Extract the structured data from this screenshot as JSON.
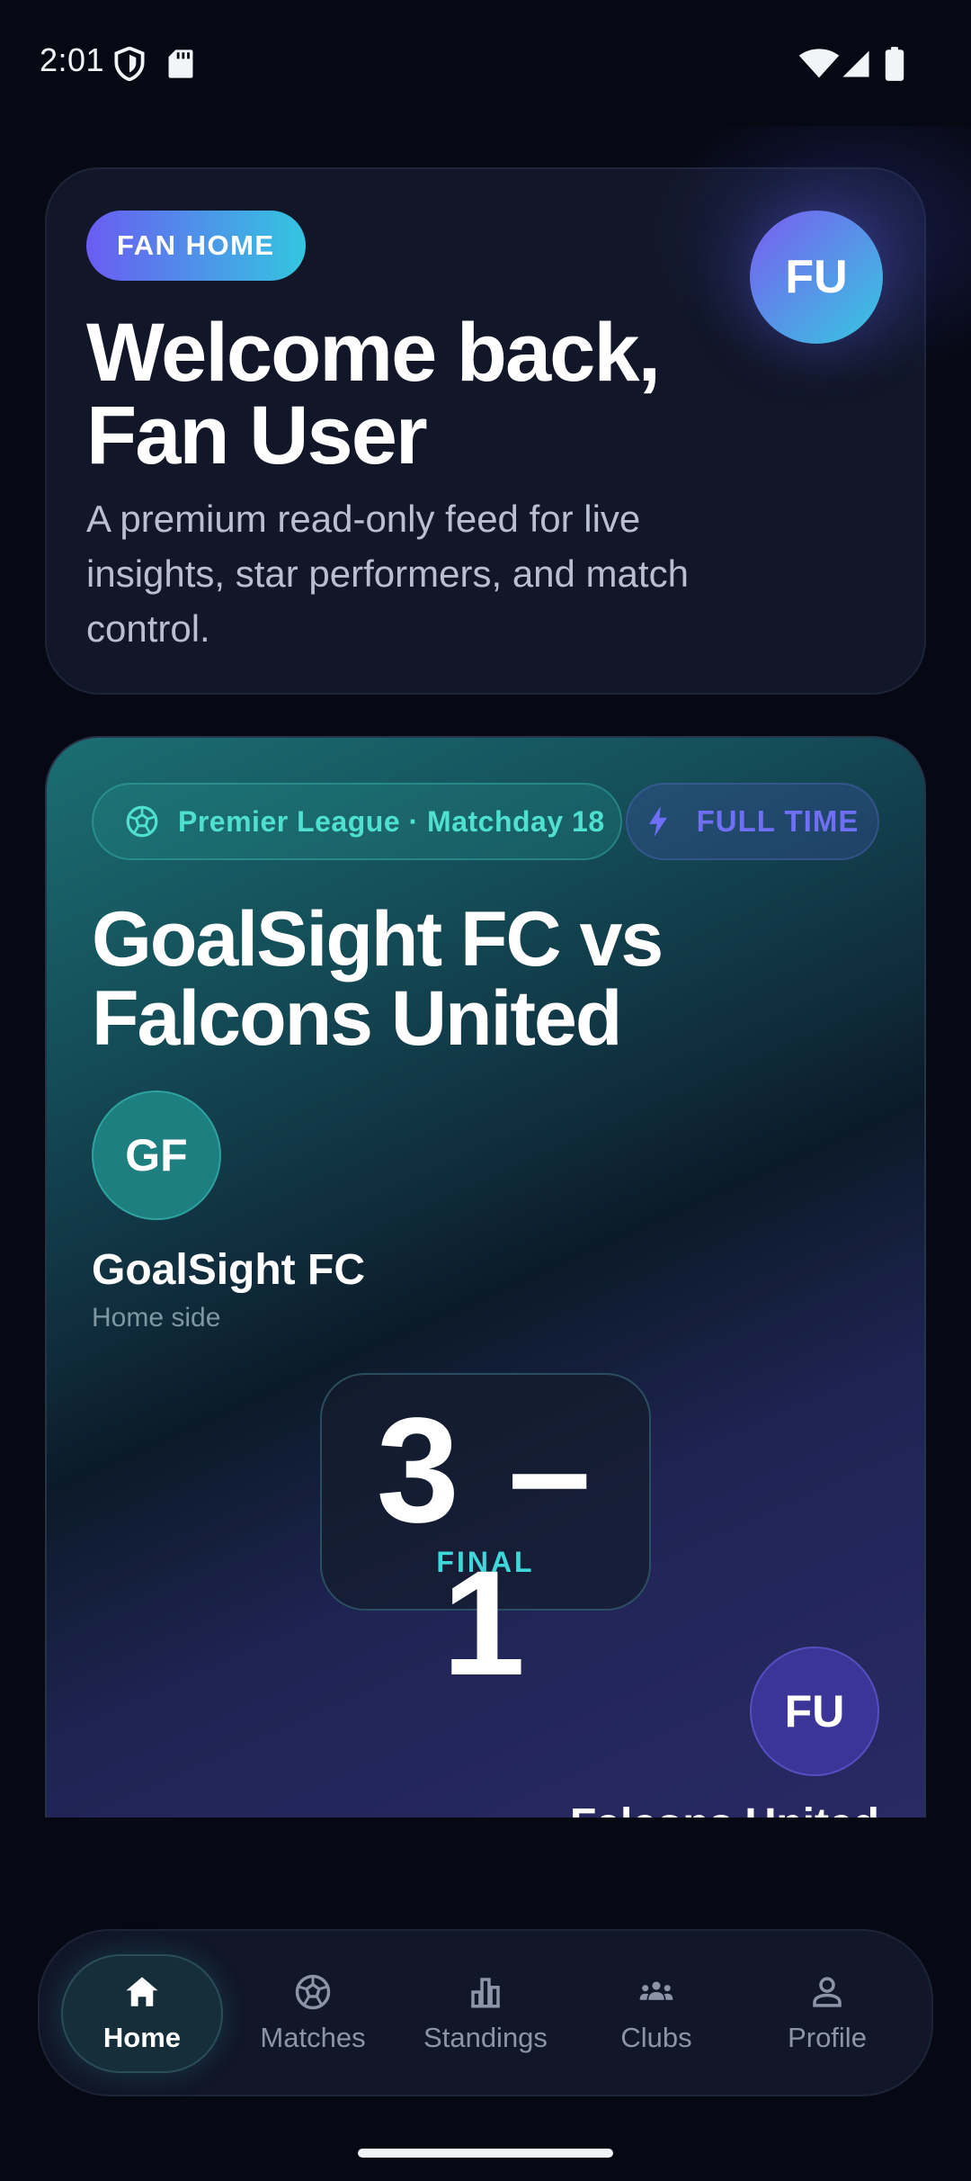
{
  "status_bar": {
    "time": "2:01"
  },
  "hero": {
    "badge": "FAN HOME",
    "avatar_initials": "FU",
    "title_line1": "Welcome back,",
    "title_line2": "Fan User",
    "subtitle": "A premium read-only feed for live insights, star performers, and match control."
  },
  "match": {
    "league": "Premier League · Matchday 18",
    "status": "FULL TIME",
    "title_line1": "GoalSight FC vs",
    "title_line2": "Falcons United",
    "home": {
      "initials": "GF",
      "name": "GoalSight FC",
      "role": "Home side"
    },
    "score": "3 – 1",
    "score_label": "FINAL",
    "away": {
      "initials": "FU",
      "name": "Falcons United"
    }
  },
  "nav": {
    "items": [
      {
        "label": "Home",
        "icon": "home-icon",
        "active": true
      },
      {
        "label": "Matches",
        "icon": "soccer-ball-icon",
        "active": false
      },
      {
        "label": "Standings",
        "icon": "bar-chart-icon",
        "active": false
      },
      {
        "label": "Clubs",
        "icon": "groups-icon",
        "active": false
      },
      {
        "label": "Profile",
        "icon": "person-icon",
        "active": false
      }
    ]
  },
  "colors": {
    "background": "#060813",
    "card": "#111628",
    "accent_cyan": "#3fd8da",
    "accent_purple": "#6a5cf2"
  }
}
